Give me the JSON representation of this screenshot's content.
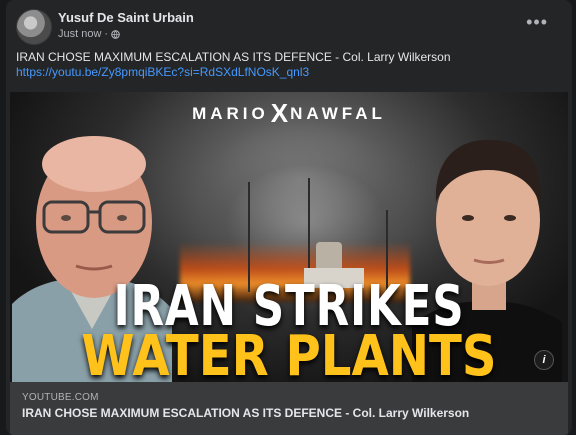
{
  "post": {
    "author": "Yusuf De Saint Urbain",
    "timestamp": "Just now",
    "audience_separator": "·",
    "audience_icon": "globe-icon",
    "more_label": "•••",
    "text": "IRAN CHOSE MAXIMUM ESCALATION AS ITS DEFENCE - Col. Larry Wilkerson",
    "link": "https://youtu.be/Zy8pmqiBKEc?si=RdSXdLfNOsK_qnl3"
  },
  "preview": {
    "logo_left": "MARIO",
    "logo_mark": "X",
    "logo_right": "NAWFAL",
    "headline_line1": "IRAN STRIKES",
    "headline_line2": "WATER PLANTS",
    "info_label": "i"
  },
  "link_card": {
    "domain": "YOUTUBE.COM",
    "title": "IRAN CHOSE MAXIMUM ESCALATION AS ITS DEFENCE - Col. Larry Wilkerson"
  },
  "colors": {
    "card_bg": "#242526",
    "link": "#4599ff",
    "headline_yellow": "#ffc21a",
    "footer_bg": "#3a3b3c"
  }
}
